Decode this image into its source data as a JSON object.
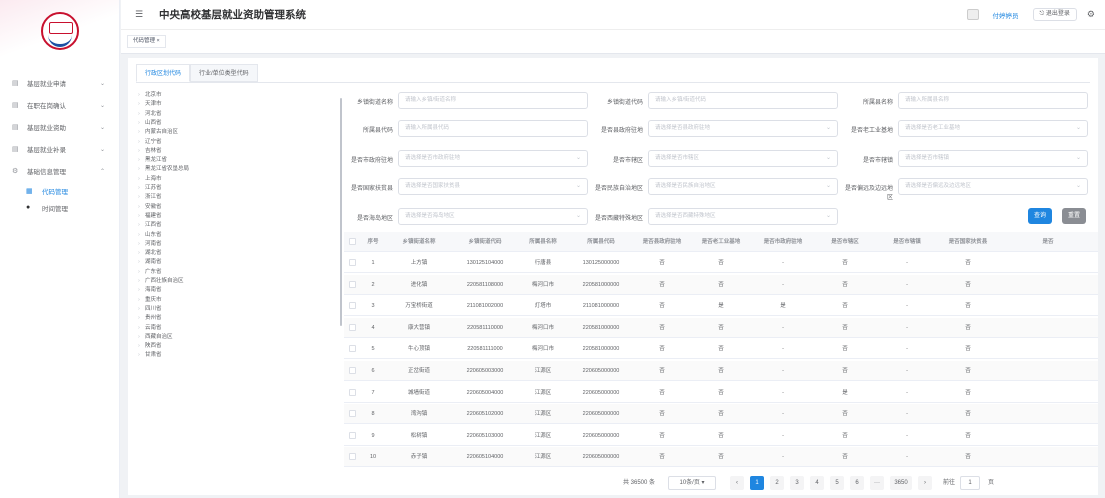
{
  "header": {
    "title": "中央高校基层就业资助管理系统",
    "user": "付婷婷员",
    "logout": "⎋ 退出登录"
  },
  "tags": {
    "current": "代码管理 ×"
  },
  "sidebar": {
    "items": [
      {
        "label": "基层就业申请",
        "icon": "document-icon"
      },
      {
        "label": "在职在岗确认",
        "icon": "document-icon"
      },
      {
        "label": "基层就业资助",
        "icon": "document-icon"
      },
      {
        "label": "基层就业补录",
        "icon": "document-icon"
      },
      {
        "label": "基础信息管理",
        "icon": "settings-icon"
      }
    ],
    "subitems": [
      {
        "label": "代码管理",
        "icon": "grid-icon"
      },
      {
        "label": "时间管理",
        "icon": "dot-icon"
      }
    ]
  },
  "tabs": [
    "行政区划代码",
    "行业/单位类型代码"
  ],
  "tree": [
    "北京市",
    "天津市",
    "河北省",
    "山西省",
    "内蒙古自治区",
    "辽宁省",
    "吉林省",
    "黑龙江省",
    "黑龙江省农垦总局",
    "上海市",
    "江苏省",
    "浙江省",
    "安徽省",
    "福建省",
    "江西省",
    "山东省",
    "河南省",
    "湖北省",
    "湖南省",
    "广东省",
    "广西壮族自治区",
    "海南省",
    "重庆市",
    "四川省",
    "贵州省",
    "云南省",
    "西藏自治区",
    "陕西省",
    "甘肃省"
  ],
  "filters": [
    {
      "label": "乡镇街道名称",
      "placeholder": "请输入乡镇/街道名称",
      "type": "input"
    },
    {
      "label": "乡镇街道代码",
      "placeholder": "请输入乡镇/街道代码",
      "type": "input"
    },
    {
      "label": "所属县名称",
      "placeholder": "请输入所属县名称",
      "type": "input"
    },
    {
      "label": "所属县代码",
      "placeholder": "请输入所属县代码",
      "type": "input"
    },
    {
      "label": "是否县政府驻地",
      "placeholder": "请选择是否县政府驻地",
      "type": "select"
    },
    {
      "label": "是否老工业基地",
      "placeholder": "请选择是否老工业基地",
      "type": "select"
    },
    {
      "label": "是否市政府驻地",
      "placeholder": "请选择是否市政府驻地",
      "type": "select"
    },
    {
      "label": "是否市辖区",
      "placeholder": "请选择是否市辖区",
      "type": "select"
    },
    {
      "label": "是否市辖镇",
      "placeholder": "请选择是否市辖镇",
      "type": "select"
    },
    {
      "label": "是否国家扶贫县",
      "placeholder": "请选择是否国家扶贫县",
      "type": "select"
    },
    {
      "label": "是否民族自治地区",
      "placeholder": "请选择是否民族自治地区",
      "type": "select"
    },
    {
      "label": "是否偏远及边远地区",
      "placeholder": "请选择是否偏远及边远地区",
      "type": "select"
    },
    {
      "label": "是否海岛地区",
      "placeholder": "请选择是否海岛地区",
      "type": "select"
    },
    {
      "label": "是否西藏特殊地区",
      "placeholder": "请选择是否西藏特殊地区",
      "type": "select"
    }
  ],
  "buttons": {
    "query": "查询",
    "reset": "重置"
  },
  "table": {
    "columns": [
      "序号",
      "乡镇街道名称",
      "乡镇街道代码",
      "所属县名称",
      "所属县代码",
      "是否县政府驻地",
      "是否老工业基地",
      "是否市政府驻地",
      "是否市辖区",
      "是否市辖镇",
      "是否国家扶贫县",
      "是否"
    ],
    "rows": [
      [
        "1",
        "上方镇",
        "130125104000",
        "行唐县",
        "130125000000",
        "否",
        "否",
        "-",
        "否",
        "-",
        "否"
      ],
      [
        "2",
        "进化镇",
        "220581108000",
        "梅河口市",
        "220581000000",
        "否",
        "否",
        "-",
        "否",
        "-",
        "否"
      ],
      [
        "3",
        "万宝桥街道",
        "211081002000",
        "灯塔市",
        "211081000000",
        "否",
        "是",
        "是",
        "否",
        "-",
        "否"
      ],
      [
        "4",
        "康大营镇",
        "220581110000",
        "梅河口市",
        "220581000000",
        "否",
        "否",
        "-",
        "否",
        "-",
        "否"
      ],
      [
        "5",
        "牛心顶镇",
        "220581111000",
        "梅河口市",
        "220581000000",
        "否",
        "否",
        "-",
        "否",
        "-",
        "否"
      ],
      [
        "6",
        "正岔街道",
        "220605003000",
        "江源区",
        "220605000000",
        "否",
        "否",
        "-",
        "否",
        "-",
        "否"
      ],
      [
        "7",
        "城墙街道",
        "220605004000",
        "江源区",
        "220605000000",
        "否",
        "否",
        "-",
        "是",
        "-",
        "否"
      ],
      [
        "8",
        "湾沟镇",
        "220605102000",
        "江源区",
        "220605000000",
        "否",
        "否",
        "-",
        "否",
        "-",
        "否"
      ],
      [
        "9",
        "松树镇",
        "220605103000",
        "江源区",
        "220605000000",
        "否",
        "否",
        "-",
        "否",
        "-",
        "否"
      ],
      [
        "10",
        "赤子镇",
        "220605104000",
        "江源区",
        "220605000000",
        "否",
        "否",
        "-",
        "否",
        "-",
        "否"
      ]
    ]
  },
  "pagination": {
    "total": "共 36500 条",
    "page_size": "10条/页 ▾",
    "pages": [
      "1",
      "2",
      "3",
      "4",
      "5",
      "6",
      "···",
      "3650"
    ],
    "goto_label": "前往",
    "goto_value": "1",
    "goto_suffix": "页",
    "prev": "‹",
    "next": "›"
  }
}
